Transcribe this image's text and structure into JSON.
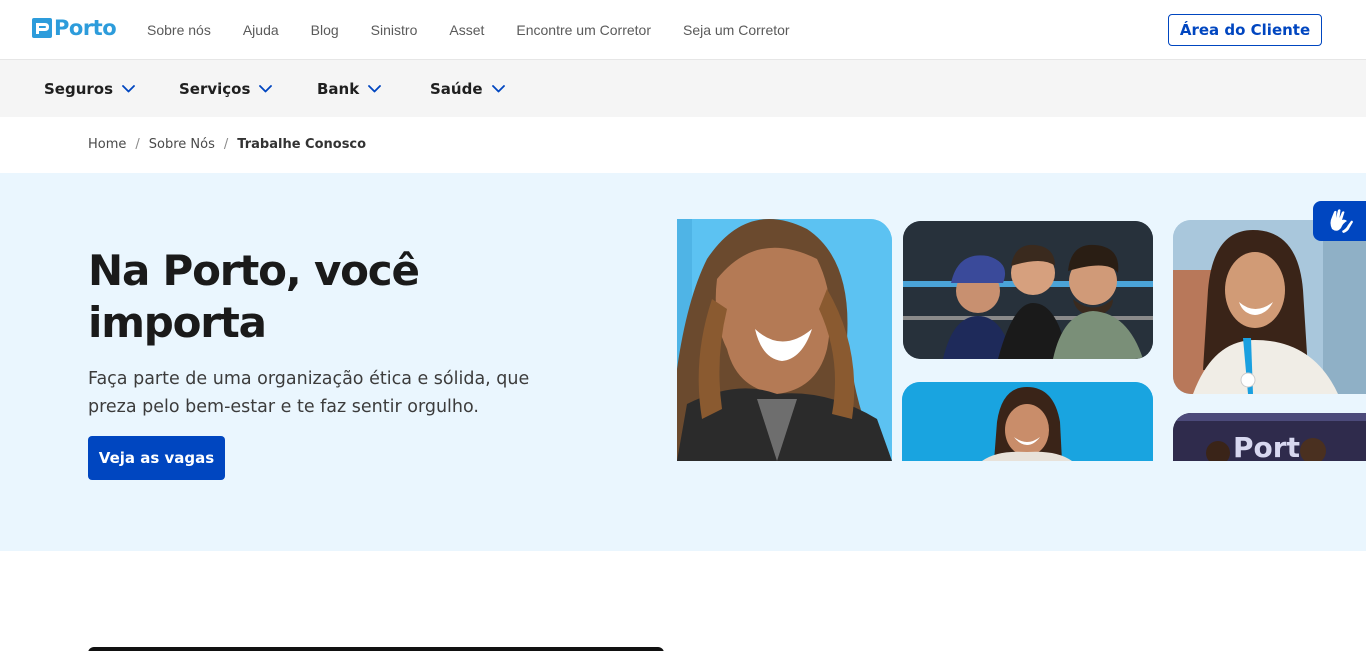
{
  "header": {
    "logo_text": "Porto",
    "nav": [
      "Sobre nós",
      "Ajuda",
      "Blog",
      "Sinistro",
      "Asset",
      "Encontre um Corretor",
      "Seja um Corretor"
    ],
    "client_button": "Área do Cliente"
  },
  "menu": {
    "items": [
      "Seguros",
      "Serviços",
      "Bank",
      "Saúde"
    ]
  },
  "breadcrumb": {
    "items": [
      "Home",
      "Sobre Nós"
    ],
    "current": "Trabalhe Conosco"
  },
  "hero": {
    "title": "Na Porto, você importa",
    "subtitle": "Faça parte de uma organização ética e sólida, que preza pelo bem-estar e te faz sentir orgulho.",
    "cta": "Veja as vagas"
  },
  "colors": {
    "brand_blue": "#0046c0",
    "logo_blue": "#2d9cdb",
    "hero_bg": "#eaf6fe",
    "menu_bg": "#f5f5f5"
  },
  "icons": {
    "chevron": "chevron-down-icon",
    "accessibility": "sign-language-icon"
  }
}
